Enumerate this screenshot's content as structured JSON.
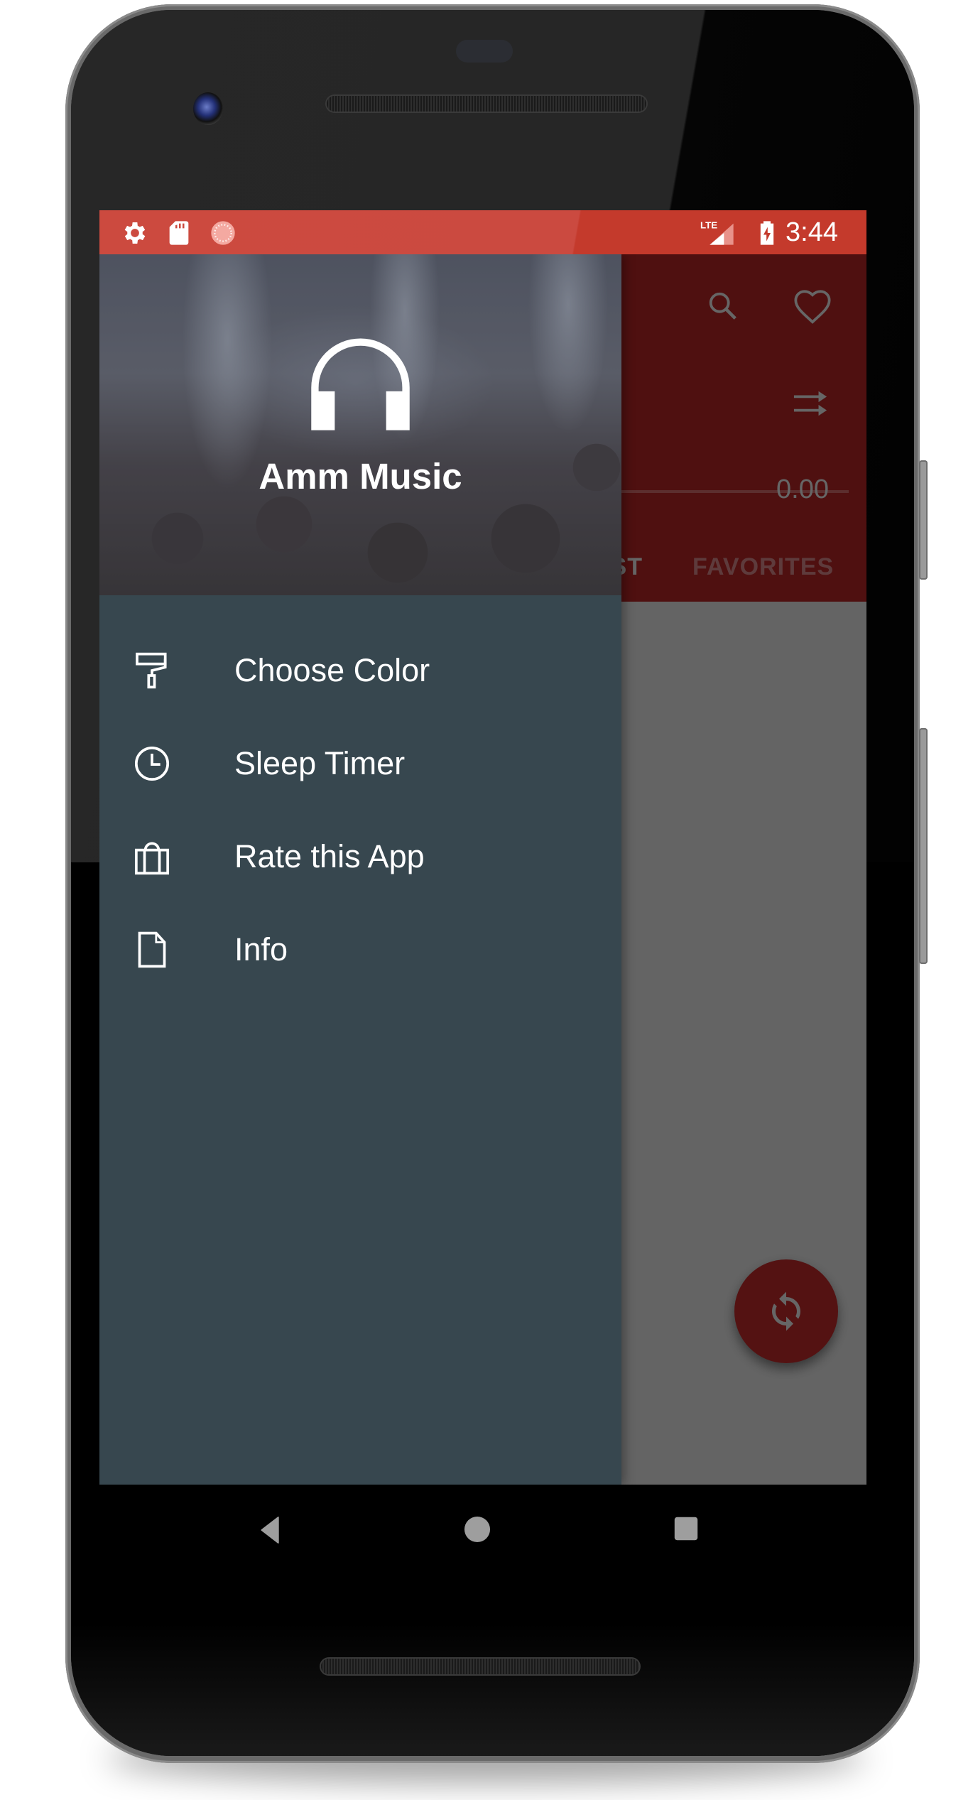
{
  "status_bar": {
    "left_icons": [
      "settings-icon",
      "sd-card-icon",
      "sync-progress-icon"
    ],
    "right_icons": [
      "lte-signal-icon",
      "battery-charging-icon"
    ],
    "network_label": "LTE",
    "time": "3:44",
    "color": "#cc4a3f"
  },
  "app": {
    "toolbar_color": "#c62828",
    "toolbar_icons": [
      "search-icon",
      "heart-icon",
      "shuffle-icon"
    ],
    "progress": {
      "value": 0,
      "time_label": "0.00"
    },
    "tabs": [
      {
        "label": "PLAYLIST",
        "visible_fragment": "ST"
      },
      {
        "label": "FAVORITES"
      }
    ],
    "fab": {
      "icon": "refresh-icon",
      "color": "#d32f2f"
    }
  },
  "drawer": {
    "background": "#37474f",
    "header": {
      "logo_icon": "headphones-icon",
      "app_name": "Amm Music"
    },
    "items": [
      {
        "label": "Choose Color",
        "icon": "paint-roller-icon"
      },
      {
        "label": "Sleep Timer",
        "icon": "clock-icon"
      },
      {
        "label": "Rate this App",
        "icon": "shopping-bag-icon"
      },
      {
        "label": "Info",
        "icon": "document-icon"
      }
    ]
  },
  "nav_bar": {
    "buttons": [
      "back",
      "home",
      "recents"
    ]
  }
}
